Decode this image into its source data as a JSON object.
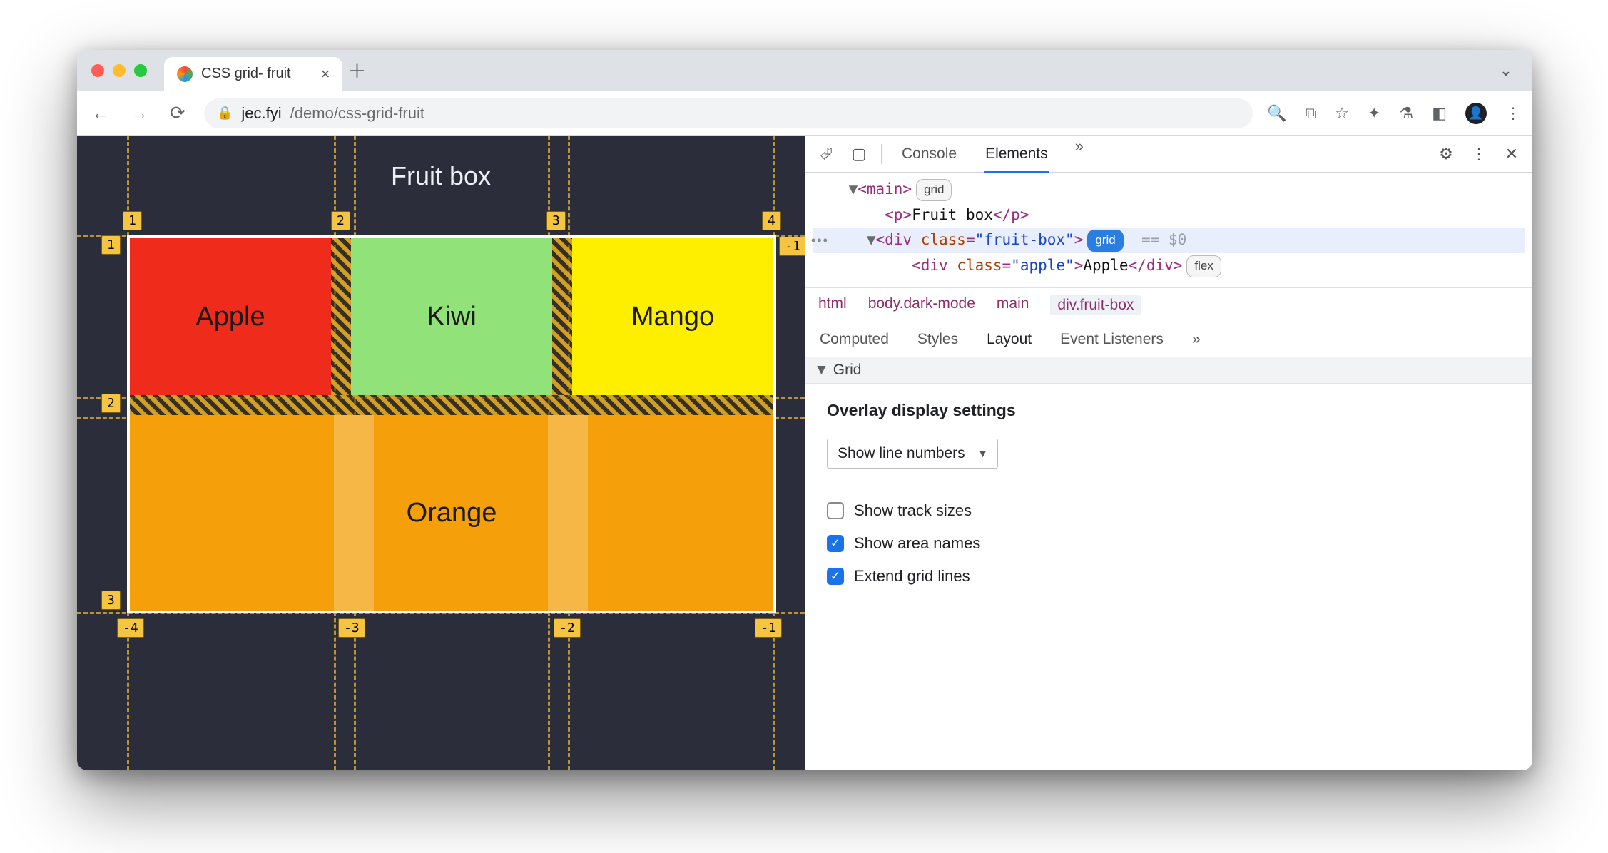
{
  "browser": {
    "tab_title": "CSS grid- fruit",
    "url_host": "jec.fyi",
    "url_path": "/demo/css-grid-fruit"
  },
  "page": {
    "heading": "Fruit box",
    "cells": {
      "apple": "Apple",
      "kiwi": "Kiwi",
      "mango": "Mango",
      "orange": "Orange"
    },
    "top_labels": [
      "1",
      "2",
      "3",
      "4"
    ],
    "top_right_neg": "-1",
    "left_labels": [
      "1",
      "2",
      "3"
    ],
    "bottom_labels": [
      "-4",
      "-3",
      "-2",
      "-1"
    ]
  },
  "devtools": {
    "tabs": {
      "console": "Console",
      "elements": "Elements"
    },
    "dom": {
      "main_open": "<main>",
      "main_badge": "grid",
      "p_open": "<p>",
      "p_text": "Fruit box",
      "p_close": "</p>",
      "div_open1": "<div ",
      "div_class_attr": "class",
      "div_class_val": "\"fruit-box\"",
      "div_open_close": ">",
      "div_badge": "grid",
      "selected_tail": "== $0",
      "child_open": "<div ",
      "child_class_val": "\"apple\"",
      "child_text": "Apple",
      "child_close": "</div>",
      "child_badge": "flex"
    },
    "breadcrumb": [
      "html",
      "body.dark-mode",
      "main",
      "div.fruit-box"
    ],
    "subtabs": {
      "computed": "Computed",
      "styles": "Styles",
      "layout": "Layout",
      "listeners": "Event Listeners"
    },
    "grid_section": "Grid",
    "overlay_heading": "Overlay display settings",
    "select_value": "Show line numbers",
    "checks": {
      "track_sizes": {
        "label": "Show track sizes",
        "checked": false
      },
      "area_names": {
        "label": "Show area names",
        "checked": true
      },
      "extend_lines": {
        "label": "Extend grid lines",
        "checked": true
      }
    }
  }
}
